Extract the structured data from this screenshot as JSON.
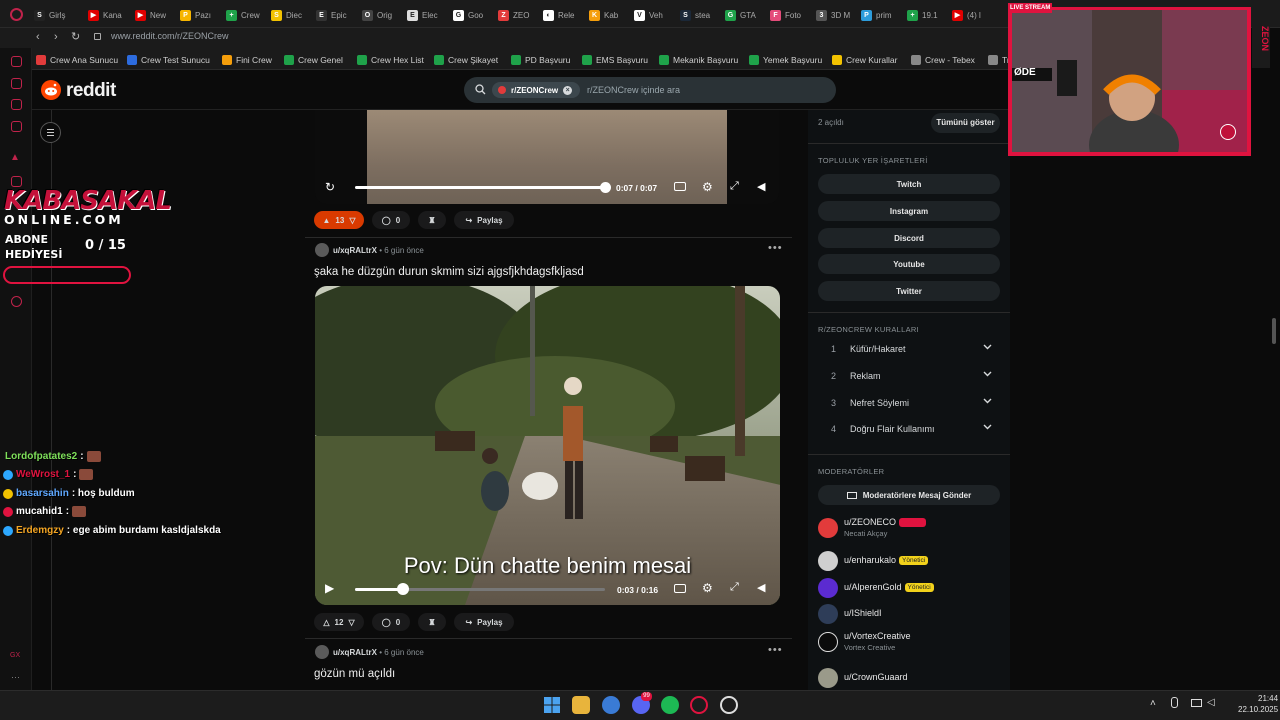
{
  "browser": {
    "url": "www.reddit.com/r/ZEONCrew",
    "tabs": [
      {
        "label": "Girlş",
        "color": "#222222",
        "glyph": "S"
      },
      {
        "label": "Kana",
        "color": "#e00000",
        "glyph": "▶"
      },
      {
        "label": "New",
        "color": "#e00000",
        "glyph": "▶"
      },
      {
        "label": "Pazı",
        "color": "#f7b500",
        "glyph": "P"
      },
      {
        "label": "Crew",
        "color": "#1fa24a",
        "glyph": "+"
      },
      {
        "label": "Diec",
        "color": "#f2c200",
        "glyph": "S"
      },
      {
        "label": "Epic",
        "color": "#333333",
        "glyph": "E"
      },
      {
        "label": "Orig",
        "color": "#444444",
        "glyph": "O"
      },
      {
        "label": "Elec",
        "color": "#dddddd",
        "glyph": "E"
      },
      {
        "label": "Goo",
        "color": "#ffffff",
        "glyph": "G"
      },
      {
        "label": "ZEO",
        "color": "#e23b3b",
        "glyph": "Z"
      },
      {
        "label": "Rele",
        "color": "#ffffff",
        "glyph": "◐"
      },
      {
        "label": "Kab",
        "color": "#f59e0b",
        "glyph": "K"
      },
      {
        "label": "Veh",
        "color": "#ffffff",
        "glyph": "V"
      },
      {
        "label": "stea",
        "color": "#1b2838",
        "glyph": "S"
      },
      {
        "label": "GTA",
        "color": "#1fa24a",
        "glyph": "G"
      },
      {
        "label": "Foto",
        "color": "#e44c7a",
        "glyph": "F"
      },
      {
        "label": "3D M",
        "color": "#555555",
        "glyph": "3"
      },
      {
        "label": "prim",
        "color": "#2d9cdb",
        "glyph": "P"
      },
      {
        "label": "19.1",
        "color": "#1fa24a",
        "glyph": "+"
      },
      {
        "label": "(4) l",
        "color": "#e00000",
        "glyph": "▶"
      }
    ],
    "bookmarks": [
      {
        "label": "Crew Ana Sunucu",
        "color": "#e23b3b"
      },
      {
        "label": "Crew Test Sunucu",
        "color": "#2d6cdf"
      },
      {
        "label": "Fini Crew",
        "color": "#f59e0b"
      },
      {
        "label": "Crew Genel",
        "color": "#1fa24a"
      },
      {
        "label": "Crew Hex List",
        "color": "#1fa24a"
      },
      {
        "label": "Crew Şikayet",
        "color": "#1fa24a"
      },
      {
        "label": "PD Başvuru",
        "color": "#1fa24a"
      },
      {
        "label": "EMS Başvuru",
        "color": "#1fa24a"
      },
      {
        "label": "Mekanik Başvuru",
        "color": "#1fa24a"
      },
      {
        "label": "Yemek Başvuru",
        "color": "#1fa24a"
      },
      {
        "label": "Crew Kurallar",
        "color": "#f2c200"
      },
      {
        "label": "Crew - Tebex",
        "color": "#888888"
      },
      {
        "label": "Tr",
        "color": "#888888"
      }
    ]
  },
  "reddit": {
    "logo": "reddit",
    "search_chip": "r/ZEONCrew",
    "search_placeholder": "r/ZEONCrew içinde ara"
  },
  "posts": [
    {
      "upvotes": "13",
      "comments": "0",
      "share": "Paylaş",
      "video_time": "0:07 / 0:07",
      "progress": 1.0
    },
    {
      "author": "u/xqRALtrX",
      "age": "6 gün önce",
      "title": "şaka he düzgün durun skmim sizi ajgsfjkhdagsfkljasd",
      "caption": "Pov: Dün chatte benim mesai",
      "video_time": "0:03 / 0:16",
      "progress": 0.19,
      "upvotes": "12",
      "comments": "0",
      "share": "Paylaş"
    },
    {
      "author": "u/xqRALtrX",
      "age": "6 gün önce",
      "title": "gözün mü açıldı"
    }
  ],
  "sidebar": {
    "saved_label": "2 açıldı",
    "show_all": "Tümünü göster",
    "bookmarks_heading": "TOPLULUK YER İŞARETLERİ",
    "bookmark_buttons": [
      "Twitch",
      "Instagram",
      "Discord",
      "Youtube",
      "Twitter"
    ],
    "rules_heading": "R/ZEONCREW KURALLARI",
    "rules": [
      {
        "num": "1",
        "text": "Küfür/Hakaret"
      },
      {
        "num": "2",
        "text": "Reklam"
      },
      {
        "num": "3",
        "text": "Nefret Söylemi"
      },
      {
        "num": "4",
        "text": "Doğru Flair Kullanımı"
      }
    ],
    "mods_heading": "MODERATÖRLER",
    "message_mods": "Moderatörlere Mesaj Gönder",
    "moderators": [
      {
        "name": "u/ZEONECO",
        "sub": "Necati Akçay",
        "flair": "Kurucu",
        "flair_color": "#e0133f",
        "avatar": "#e23b3b"
      },
      {
        "name": "u/enharukalo",
        "sub": "",
        "flair": "Yönetici",
        "flair_color": "#f2d21b",
        "avatar": "#cfcfcf"
      },
      {
        "name": "u/AlperenGold",
        "sub": "",
        "flair": "Yönetici",
        "flair_color": "#f2d21b",
        "avatar": "#5b2bd1"
      },
      {
        "name": "u/IShieldI",
        "sub": "",
        "flair": "",
        "flair_color": "",
        "avatar": "#2e3d58"
      },
      {
        "name": "u/VortexCreative",
        "sub": "Vortex Creative",
        "flair": "",
        "flair_color": "",
        "avatar": "#0b0b0b"
      },
      {
        "name": "u/CrownGuaard",
        "sub": "",
        "flair": "",
        "flair_color": "",
        "avatar": "#9a9a8a"
      }
    ]
  },
  "overlay": {
    "logo_top": "KABASAKAL",
    "logo_bottom": "ONLINE.COM",
    "sub_goal_label": "ABONE HEDİYESİ",
    "sub_goal_count": "0 / 15",
    "chat": [
      {
        "user": "Lordofpatates2",
        "color": "#7ee05a",
        "msg": ":",
        "emote": true,
        "badge": ""
      },
      {
        "user": "WeWrost_1",
        "color": "#e0133f",
        "msg": ":",
        "emote": true,
        "badge": "#2da8ff"
      },
      {
        "user": "basarsahin",
        "color": "#5fa8ff",
        "msg": ": hoş buldum",
        "emote": false,
        "badge": "#f2c200"
      },
      {
        "user": "mucahid1",
        "color": "#ffffff",
        "msg": ":",
        "emote": true,
        "badge": "#e0133f"
      },
      {
        "user": "Erdemgzy",
        "color": "#f5a623",
        "msg": ": ege abim burdamı kasldjalskda",
        "emote": false,
        "badge": "#2da8ff"
      }
    ]
  },
  "webcam": {
    "banner": "LIVE STREAM",
    "tag": "ØDE",
    "side_text": "ZEON"
  },
  "taskbar": {
    "time": "21:44",
    "date": "22.10.2025",
    "discord_badge": "99"
  }
}
